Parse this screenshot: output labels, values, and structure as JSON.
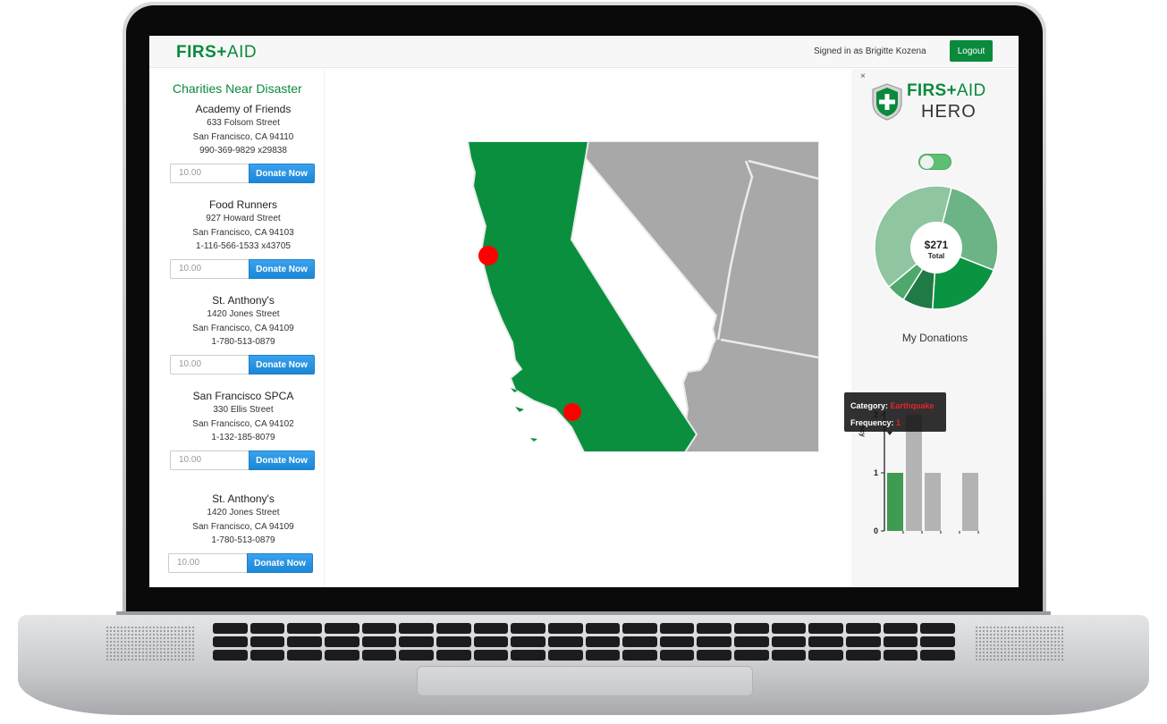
{
  "header": {
    "brand_bold": "FIRS",
    "brand_plus": "+",
    "brand_rest": "AID",
    "signed_in": "Signed in as Brigitte Kozena",
    "logout_label": "Logout"
  },
  "charities": {
    "title": "Charities Near Disaster",
    "donate_label": "Donate Now",
    "items": [
      {
        "name": "Academy of Friends",
        "street": "633 Folsom Street",
        "city": "San Francisco, CA 94110",
        "phone": "990-369-9829 x29838",
        "amount": "10.00"
      },
      {
        "name": "Food Runners",
        "street": "927 Howard Street",
        "city": "San Francisco, CA 94103",
        "phone": "1-116-566-1533 x43705",
        "amount": "10.00"
      },
      {
        "name": "St. Anthony's",
        "street": "1420 Jones Street",
        "city": "San Francisco, CA 94109",
        "phone": "1-780-513-0879",
        "amount": "10.00"
      },
      {
        "name": "San Francisco SPCA",
        "street": "330 Ellis Street",
        "city": "San Francisco, CA 94102",
        "phone": "1-132-185-8079",
        "amount": "10.00"
      },
      {
        "name": "St. Anthony's",
        "street": "1420 Jones Street",
        "city": "San Francisco, CA 94109",
        "phone": "1-780-513-0879",
        "amount": "10.00"
      }
    ]
  },
  "map": {
    "highlight_color": "#0a8f3e",
    "neighbor_color": "#a8a8a8",
    "marker_color": "#ff0000"
  },
  "hero": {
    "close_glyph": "×",
    "brand_bold": "FIRS",
    "brand_plus": "+",
    "brand_rest": "AID",
    "subtitle": "HERO",
    "toggle_on": true,
    "donut_total_value": "$271",
    "donut_total_label": "Total",
    "donations_title": "My Donations",
    "tooltip": {
      "category_label": "Category:",
      "category_value": "Earthquake",
      "frequency_label": "Frequency:",
      "frequency_value": "1"
    }
  },
  "chart_data": [
    {
      "type": "pie",
      "title": "",
      "slices": [
        {
          "value": 0.27,
          "color": "#6cb385"
        },
        {
          "value": 0.2,
          "color": "#0a9442"
        },
        {
          "value": 0.08,
          "color": "#1f7a45"
        },
        {
          "value": 0.05,
          "color": "#4ea86b"
        },
        {
          "value": 0.4,
          "color": "#8fc5a0"
        }
      ]
    },
    {
      "type": "bar",
      "ylabel": "ncy",
      "ylim": [
        0,
        2
      ],
      "yticks": [
        "0",
        "1",
        "2"
      ],
      "values": [
        1,
        2,
        1,
        0,
        1
      ],
      "colors": [
        "#3f9b4f",
        "#b3b3b3",
        "#b3b3b3",
        "#b3b3b3",
        "#b3b3b3"
      ]
    }
  ]
}
